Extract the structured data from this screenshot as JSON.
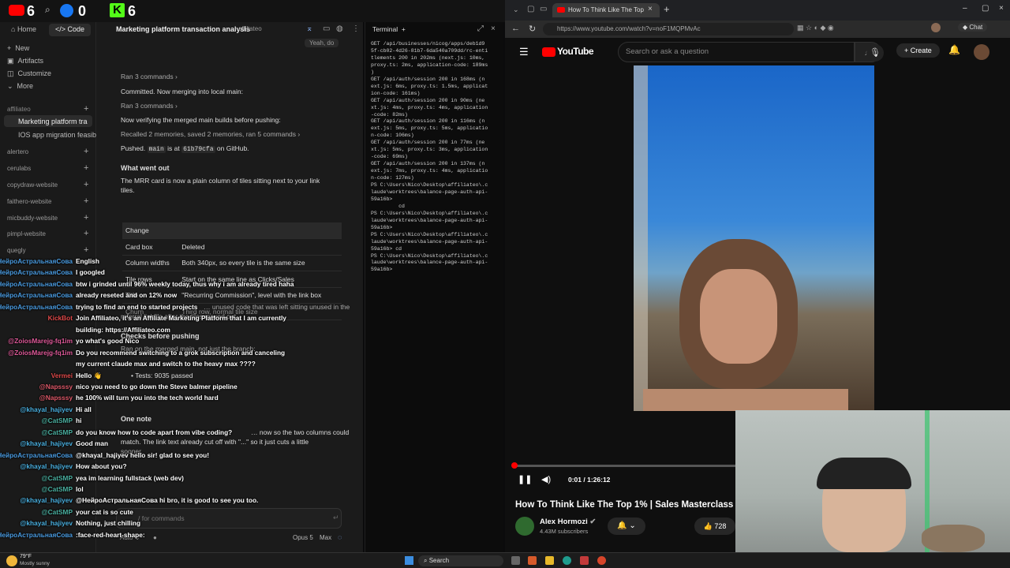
{
  "overlay_stats": {
    "yt_count": "6",
    "fb_count": "0",
    "kick_count": "6"
  },
  "claude": {
    "nav": {
      "home": "Home",
      "code": "Code"
    },
    "menu": [
      "New",
      "Artifacts",
      "Customize",
      "More"
    ],
    "projects_header": "affiliateo",
    "active_session": "Marketing platform tra",
    "session_2": "IOS app migration feasib",
    "projects": [
      "alertero",
      "cerulabs",
      "copydraw-website",
      "faithero-website",
      "micbuddy-website",
      "pimpl-website",
      "quegly"
    ],
    "session_title": "Marketing platform transaction analysis",
    "session_tag": "affiliateo",
    "yeah_bubble": "Yeah, do",
    "messages": {
      "ran1": "Ran 3 commands",
      "committed": "Committed. Now merging into local main:",
      "ran2": "Ran 3 commands",
      "verifying": "Now verifying the merged main builds before pushing:",
      "recalled": "Recalled 2 memories, saved 2 memories, ran 5 commands",
      "pushed_prefix": "Pushed.",
      "pushed_main": "main",
      "pushed_is": "is at",
      "pushed_sha": "61b79cfa",
      "pushed_suffix": "on GitHub.",
      "what_went_out": "What went out",
      "mrr_line1": "The MRR card is now a plain column of tiles sitting next to your link",
      "mrr_line2": "tiles.",
      "table": [
        [
          "Change",
          ""
        ],
        [
          "Card box",
          "Deleted"
        ],
        [
          "Column widths",
          "Both 340px, so every tile is the same size"
        ],
        [
          "Tile rows",
          "Start on the same line as Clicks/Sales"
        ],
        [
          "Title",
          "\"Recurring Commission\", level with the link box"
        ],
        [
          "Churn",
          "Third row, normal tile size"
        ]
      ],
      "unused_line": "… unused code that was left sitting unused in the",
      "referral_line": "referral linkfile after the tiles moved out.",
      "checks": "Checks before pushing",
      "ran_merged": "Ran on the merged main, not just the branch:",
      "tests": "Tests: 9035 passed",
      "one_note": "One note",
      "note_line1": "… now so the two columns could",
      "note_line2": "match. The link text already cut off with \"...\" so it just cuts a little",
      "note_line3": "sooner."
    },
    "input_placeholder": "/ for commands",
    "model": "Opus 5",
    "effort": "Max",
    "mode": "Auto"
  },
  "terminal": {
    "title": "Terminal",
    "lines": [
      "GET /api/businesses/nicog/apps/deb1d9",
      "5f-cb02-4d26-81b7-6da540a709dd/rc-enti",
      "tlements 200 in 202ms (next.js: 10ms,",
      "proxy.ts: 2ms, application-code: 189ms",
      ")",
      "GET /api/auth/session 200 in 168ms (n",
      "ext.js: 6ms, proxy.ts: 1.5ms, applicat",
      "ion-code: 161ms)",
      "GET /api/auth/session 200 in 90ms (ne",
      "xt.js: 4ms, proxy.ts: 4ms, application",
      "-code: 82ms)",
      "GET /api/auth/session 200 in 116ms (n",
      "ext.js: 5ms, proxy.ts: 5ms, applicatio",
      "n-code: 106ms)",
      "GET /api/auth/session 200 in 77ms (ne",
      "xt.js: 5ms, proxy.ts: 3ms, application",
      "-code: 69ms)",
      "GET /api/auth/session 200 in 137ms (n",
      "ext.js: 7ms, proxy.ts: 4ms, applicatio",
      "n-code: 127ms)",
      "PS C:\\Users\\Nico\\Desktop\\affiliateo\\.c",
      "laude\\worktrees\\balance-page-auth-api-",
      "59a16b>",
      "         cd",
      "PS C:\\Users\\Nico\\Desktop\\affiliateo\\.c",
      "laude\\worktrees\\balance-page-auth-api-",
      "59a16b>",
      "PS C:\\Users\\Nico\\Desktop\\affiliateo\\.c",
      "laude\\worktrees\\balance-page-auth-api-",
      "59a16b> cd",
      "PS C:\\Users\\Nico\\Desktop\\affiliateo\\.c",
      "laude\\worktrees\\balance-page-auth-api-",
      "59a16b> "
    ]
  },
  "browser": {
    "tab_title": "How To Think Like The Top 1%",
    "url": "https://www.youtube.com/watch?v=noF1MQPMvAc",
    "chat_label": "Chat",
    "yt_logo": "YouTube",
    "search_placeholder": "Search or ask a question",
    "create": "Create",
    "time": "0:01 / 1:26:12",
    "video_title": "How To Think Like The Top 1% | Sales Masterclass",
    "channel": "Alex Hormozi",
    "subscribers": "4.43M subscribers",
    "likes": "728"
  },
  "stream_chat": [
    {
      "user": "НейроАстральнаяСова",
      "text": "English",
      "ucolor": "#4a9be0"
    },
    {
      "user": "НейроАстральнаяСова",
      "text": "I googled",
      "ucolor": "#4a9be0"
    },
    {
      "user": "НейроАстральнаяСова",
      "text": "btw i grinded until 96% weekly today, thus why i am already tired haha",
      "ucolor": "#4a9be0"
    },
    {
      "user": "НейроАстральнаяСова",
      "text": "already reseted and on 12% now",
      "ucolor": "#4a9be0"
    },
    {
      "user": "НейроАстральнаяСова",
      "text": "trying to find an end to started projects",
      "ucolor": "#4a9be0"
    },
    {
      "user": "KickBot",
      "text": "Join Affiliateo, it's an Affiliate Marketing Platform that I am currently",
      "ucolor": "#e04a4a"
    },
    {
      "user": "",
      "text": "building: https://Affiliateo.com",
      "ucolor": "#e04a4a"
    },
    {
      "user": "@ZoiosMarejg-fq1im",
      "text": "yo what's good Nico",
      "ucolor": "#e05a9a"
    },
    {
      "user": "@ZoiosMarejg-fq1im",
      "text": "Do you recommend switching to a grok subscription and canceling",
      "ucolor": "#e05a9a"
    },
    {
      "user": "",
      "text": "my current claude max and switch to the heavy max ????",
      "ucolor": "#e05a9a"
    },
    {
      "user": "Vermei",
      "text": "Hello 👋",
      "ucolor": "#e04a4a"
    },
    {
      "user": "@Napsssy",
      "text": "nico you need to go down the Steve balmer pipeline",
      "ucolor": "#e05a6a"
    },
    {
      "user": "@Napsssy",
      "text": "he 100% will turn you into the tech world hard",
      "ucolor": "#e05a6a"
    },
    {
      "user": "@khayal_hajiyev",
      "text": "Hi all",
      "ucolor": "#4ab0e0"
    },
    {
      "user": "@CatSMP",
      "text": "hi",
      "ucolor": "#4ab0a0"
    },
    {
      "user": "@CatSMP",
      "text": "do you know how to code apart from vibe coding?",
      "ucolor": "#4ab0a0"
    },
    {
      "user": "@khayal_hajiyev",
      "text": "Good man",
      "ucolor": "#4ab0e0"
    },
    {
      "user": "НейроАстральнаяСова",
      "text": "@khayal_hajiyev hello sir! glad to see you!",
      "ucolor": "#4a9be0"
    },
    {
      "user": "@khayal_hajiyev",
      "text": "How about you?",
      "ucolor": "#4ab0e0"
    },
    {
      "user": "@CatSMP",
      "text": "yea im learning fullstack (web dev)",
      "ucolor": "#4ab0a0"
    },
    {
      "user": "@CatSMP",
      "text": "lol",
      "ucolor": "#4ab0a0"
    },
    {
      "user": "@khayal_hajiyev",
      "text": "@НейроАстральнаяСова hi bro, it is good to see you too.",
      "ucolor": "#4ab0e0"
    },
    {
      "user": "@CatSMP",
      "text": "your cat is so cute",
      "ucolor": "#4ab0a0"
    },
    {
      "user": "@khayal_hajiyev",
      "text": "Nothing, just chilling",
      "ucolor": "#4ab0e0"
    },
    {
      "user": "НейроАстральнаяСова",
      "text": ":face-red-heart-shape:",
      "ucolor": "#4a9be0"
    }
  ],
  "taskbar": {
    "weather_temp": "79°F",
    "weather_desc": "Mostly sunny",
    "search": "Search"
  }
}
